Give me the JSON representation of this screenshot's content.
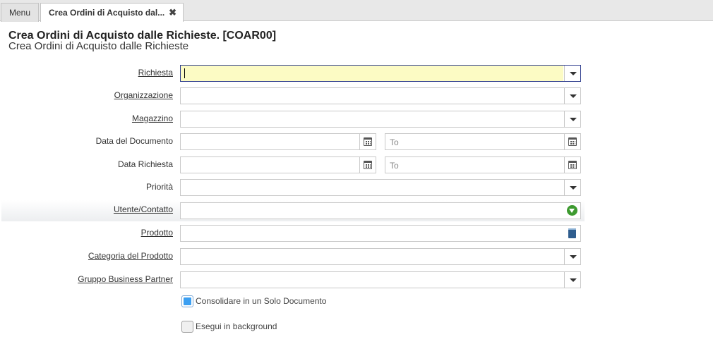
{
  "tabs": {
    "menu_label": "Menu",
    "active_label": "Crea Ordini di Acquisto dal...",
    "close_glyph": "✖"
  },
  "header": {
    "title": "Crea Ordini di Acquisto dalle Richieste. [COAR00]",
    "subtitle": "Crea Ordini di Acquisto dalle Richieste"
  },
  "form": {
    "richiesta": {
      "label": "Richiesta",
      "value": ""
    },
    "organizzazione": {
      "label": "Organizzazione",
      "value": ""
    },
    "magazzino": {
      "label": "Magazzino",
      "value": ""
    },
    "data_documento": {
      "label": "Data del Documento",
      "from": "",
      "to_placeholder": "To"
    },
    "data_richiesta": {
      "label": "Data Richiesta",
      "from": "",
      "to_placeholder": "To"
    },
    "priorita": {
      "label": "Priorità",
      "value": ""
    },
    "utente": {
      "label": "Utente/Contatto",
      "value": ""
    },
    "prodotto": {
      "label": "Prodotto",
      "value": ""
    },
    "categoria": {
      "label": "Categoria del Prodotto",
      "value": ""
    },
    "gruppo_bp": {
      "label": "Gruppo Business Partner",
      "value": ""
    }
  },
  "checkboxes": {
    "consolidare": {
      "label": "Consolidare in un Solo Documento",
      "checked": true
    },
    "background": {
      "label": "Esegui in background",
      "checked": false
    }
  },
  "colors": {
    "focus_bg": "#fcfbc4",
    "focus_border": "#2b3a8c",
    "checkbox_accent": "#3b9ff2",
    "search_icon": "#3d9a2f",
    "product_icon": "#2f5d8e"
  },
  "icons": {
    "dropdown": "chevron-down-icon",
    "calendar": "calendar-icon",
    "search": "green-arrow-search-icon",
    "product": "product-info-icon"
  }
}
